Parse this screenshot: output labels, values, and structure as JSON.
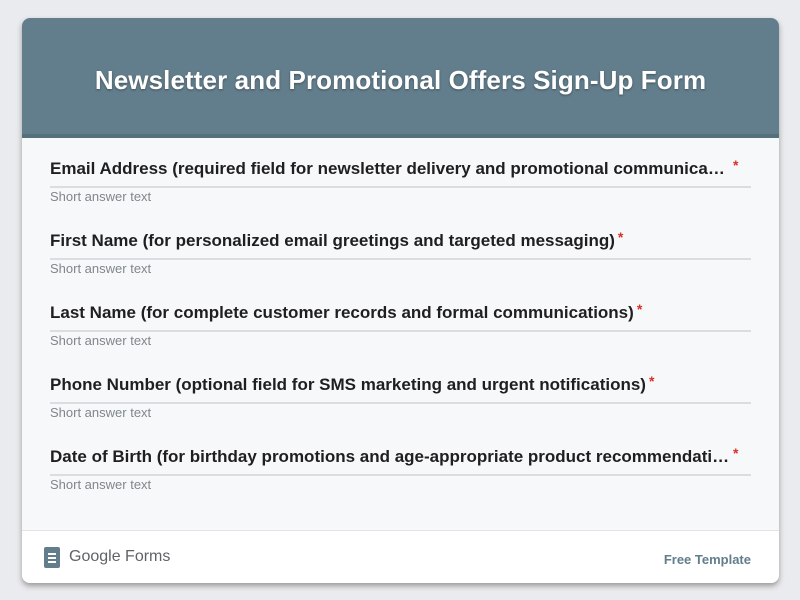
{
  "form": {
    "title": "Newsletter and Promotional Offers Sign-Up Form",
    "questions": [
      {
        "label": "Email Address (required field for newsletter delivery and promotional communicati…",
        "required": "*",
        "hint": "Short answer text"
      },
      {
        "label": "First Name (for personalized email greetings and targeted messaging)",
        "required": "*",
        "hint": "Short answer text"
      },
      {
        "label": "Last Name (for complete customer records and formal communications)",
        "required": "*",
        "hint": "Short answer text"
      },
      {
        "label": "Phone Number (optional field for SMS marketing and urgent notifications)",
        "required": "*",
        "hint": "Short answer text"
      },
      {
        "label": "Date of Birth (for birthday promotions and age-appropriate product recommendatio…",
        "required": "*",
        "hint": "Short answer text"
      }
    ]
  },
  "footer": {
    "brand": "Google Forms",
    "brand_icon": "google-forms-icon",
    "template_link": "Free Template"
  },
  "colors": {
    "header": "#627d8b",
    "required": "#d93025",
    "background": "#eaebee"
  }
}
